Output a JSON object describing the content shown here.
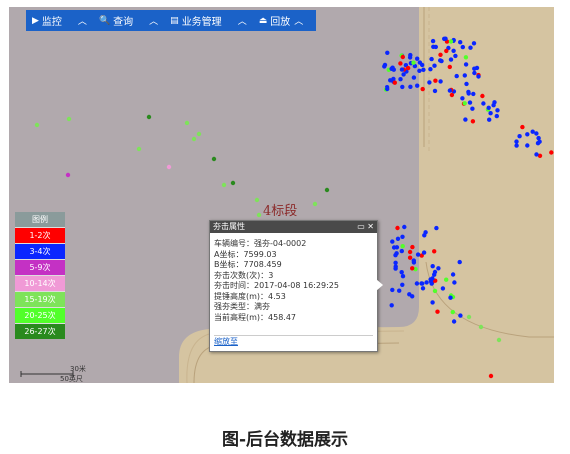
{
  "toolbar": {
    "items": [
      {
        "label": "监控",
        "icon": "play-circle-icon"
      },
      {
        "label": "查询",
        "icon": "search-icon"
      },
      {
        "label": "业务管理",
        "icon": "document-icon"
      },
      {
        "label": "回放",
        "icon": "replay-icon"
      }
    ]
  },
  "map": {
    "section_label": "4标段",
    "scale_value": "30米",
    "scale_unit": "50英尺"
  },
  "legend": {
    "title": "图例",
    "items": [
      {
        "label": "1-2次",
        "color": "#ff0000"
      },
      {
        "label": "3-4次",
        "color": "#0a26ff"
      },
      {
        "label": "5-9次",
        "color": "#c431c4"
      },
      {
        "label": "10-14次",
        "color": "#f09ad6"
      },
      {
        "label": "15-19次",
        "color": "#7ee35a"
      },
      {
        "label": "20-25次",
        "color": "#52ff2a"
      },
      {
        "label": "26-27次",
        "color": "#2a8a1e"
      }
    ]
  },
  "popup": {
    "title": "夯击属性",
    "rows": [
      "车辆编号：强夯-04-0002",
      "A坐标：7599.03",
      "B坐标：7708.459",
      "夯击次数(次)：3",
      "夯击时间：2017-04-08 16:29:25",
      "提锤高度(m)：4.53",
      "强夯类型：满夯",
      "当前高程(m)：458.47"
    ],
    "zoom_link": "缩放至"
  },
  "caption": "图-后台数据展示"
}
